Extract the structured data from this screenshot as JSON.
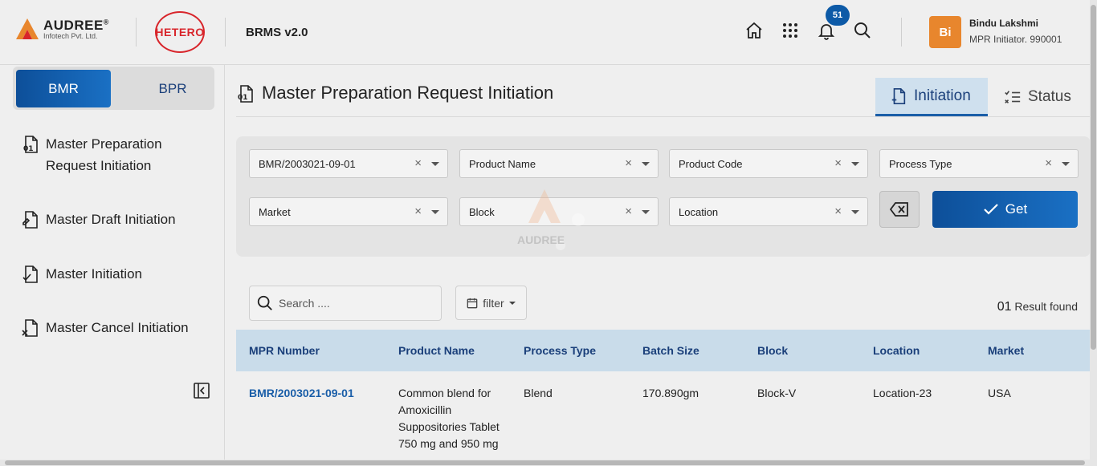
{
  "header": {
    "brand_name": "AUDREE",
    "brand_reg": "®",
    "brand_sub": "Infotech Pvt. Ltd.",
    "partner_logo": "HETERO",
    "app_title": "BRMS v2.0",
    "notification_count": "51",
    "user_initials": "Bi",
    "user_name": "Bindu Lakshmi",
    "user_role": "MPR Initiator. 990001",
    "icons": [
      "home-icon",
      "apps-grid-icon",
      "bell-icon",
      "search-icon"
    ]
  },
  "sidebar": {
    "toggle": {
      "active": "BMR",
      "inactive": "BPR"
    },
    "items": [
      {
        "label_line1": "Master Preparation",
        "label_line2": "Request Initiation",
        "icon": "document-01-icon"
      },
      {
        "label": "Master Draft Initiation",
        "icon": "document-draft-icon"
      },
      {
        "label": "Master Initiation",
        "icon": "document-check-icon"
      },
      {
        "label": "Master Cancel Initiation",
        "icon": "document-cancel-icon"
      }
    ]
  },
  "main": {
    "page_title": "Master Preparation Request Initiation",
    "tabs": [
      {
        "label": "Initiation",
        "active": true
      },
      {
        "label": "Status",
        "active": false
      }
    ],
    "filters": {
      "mpr_number": "BMR/2003021-09-01",
      "product_name": "Product Name",
      "product_code": "Product Code",
      "process_type": "Process Type",
      "market": "Market",
      "block": "Block",
      "location": "Location",
      "clear_symbol": "×",
      "get_label": "Get"
    },
    "watermark_text": "AUDREE",
    "results": {
      "search_placeholder": "Search ....",
      "filter_label": "filter",
      "count": "01",
      "count_suffix": "Result found",
      "columns": [
        "MPR Number",
        "Product Name",
        "Process Type",
        "Batch Size",
        "Block",
        "Location",
        "Market"
      ],
      "rows": [
        {
          "mpr_number": "BMR/2003021-09-01",
          "product_name_lines": [
            "Common blend for",
            "Amoxicillin",
            "Suppositories Tablet",
            "750 mg and 950 mg"
          ],
          "process_type": "Blend",
          "batch_size": "170.890gm",
          "block": "Block-V",
          "location": "Location-23",
          "market": "USA"
        }
      ]
    }
  },
  "colors": {
    "primary": "#0d4f99",
    "accent_orange": "#e8862d",
    "hetero_red": "#d8252b",
    "table_header": "#c9dcea"
  }
}
